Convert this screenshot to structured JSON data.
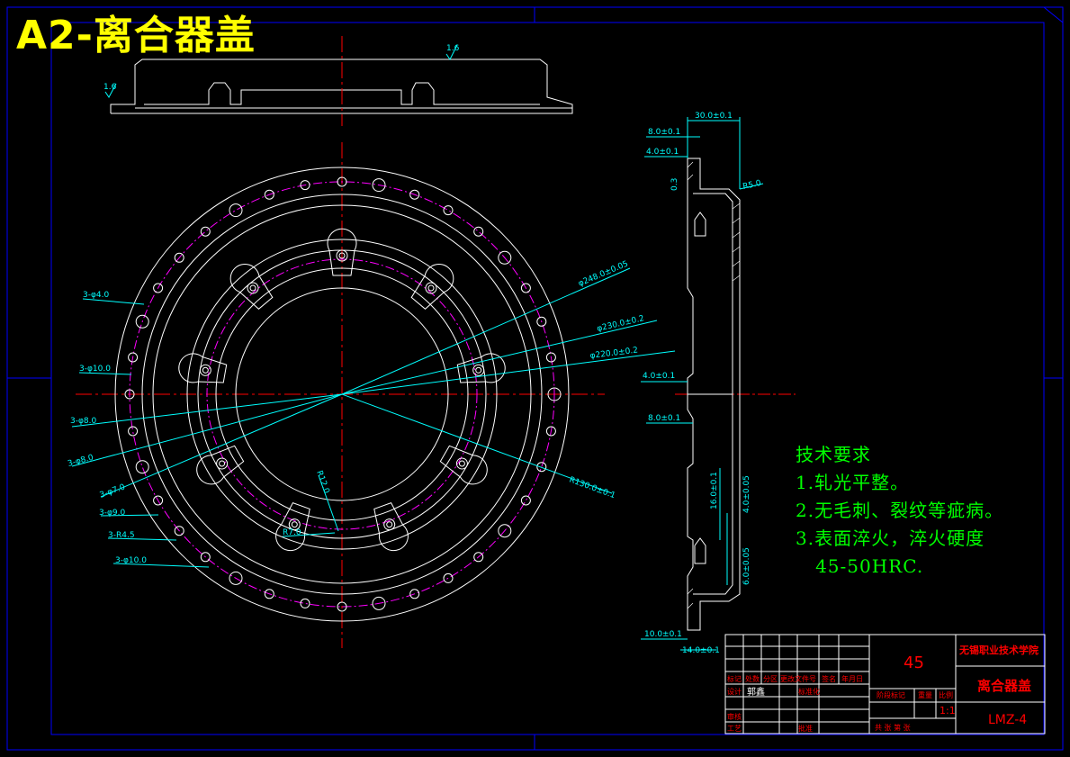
{
  "drawing": {
    "title": "A2-离合器盖"
  },
  "roughness": {
    "top": "1.6",
    "left": "1.6"
  },
  "front_view_labels": {
    "d4": "3-φ4.0",
    "d10a": "3-φ10.0",
    "d8a": "3-φ8.0",
    "d8b": "3-φ8.0",
    "d7": "3-φ7.0",
    "d9": "3-φ9.0",
    "r45": "3-R4.5",
    "d10b": "3-φ10.0",
    "r12": "R12.0",
    "r7": "R7.0",
    "dia_a": "φ248.0±0.05",
    "dia230": "φ230.0±0.2",
    "dia220": "φ220.0±0.2",
    "r130": "R130.0±0.1"
  },
  "side_view_labels": {
    "w30": "30.0±0.1",
    "w8": "8.0±0.1",
    "w4": "4.0±0.1",
    "r5": "R5.0",
    "t03": "0.3",
    "m4": "4.0±0.1",
    "m8": "8.0±0.1",
    "v16": "16.0±0.1",
    "v4": "4.0±0.05",
    "v6": "6.0±0.05",
    "b10": "10.0±0.1",
    "b14": "14.0±0.1"
  },
  "tech_requirements": {
    "heading": "技术要求",
    "items": [
      "1.轧光平整。",
      "2.无毛刺、裂纹等疵病。",
      "3.表面淬火，淬火硬度",
      "   45-50HRC."
    ]
  },
  "title_block": {
    "material": "45",
    "school": "无锡职业技术学院",
    "part_name": "离合器盖",
    "drawing_no": "LMZ-4",
    "scale": "1:1",
    "row_headers": [
      "标记",
      "处数",
      "分区",
      "更改文件号",
      "签名",
      "年月日"
    ],
    "design": "设计",
    "designer": "郭鑫",
    "standard": "标准化",
    "review": "审核",
    "process": "工艺",
    "approve": "批准",
    "stage_mark": "阶段标记",
    "weight": "重量",
    "ratio": "比例",
    "sheets": "共    张  第    张"
  },
  "colors": {
    "background": "#000000",
    "outline": "#ffffff",
    "dimension": "#00ffff",
    "centerline": "#ff0000",
    "phantom": "#ff00ff",
    "frame": "#0000ff",
    "text_green": "#00ff00",
    "title_yellow": "#ffff00"
  }
}
